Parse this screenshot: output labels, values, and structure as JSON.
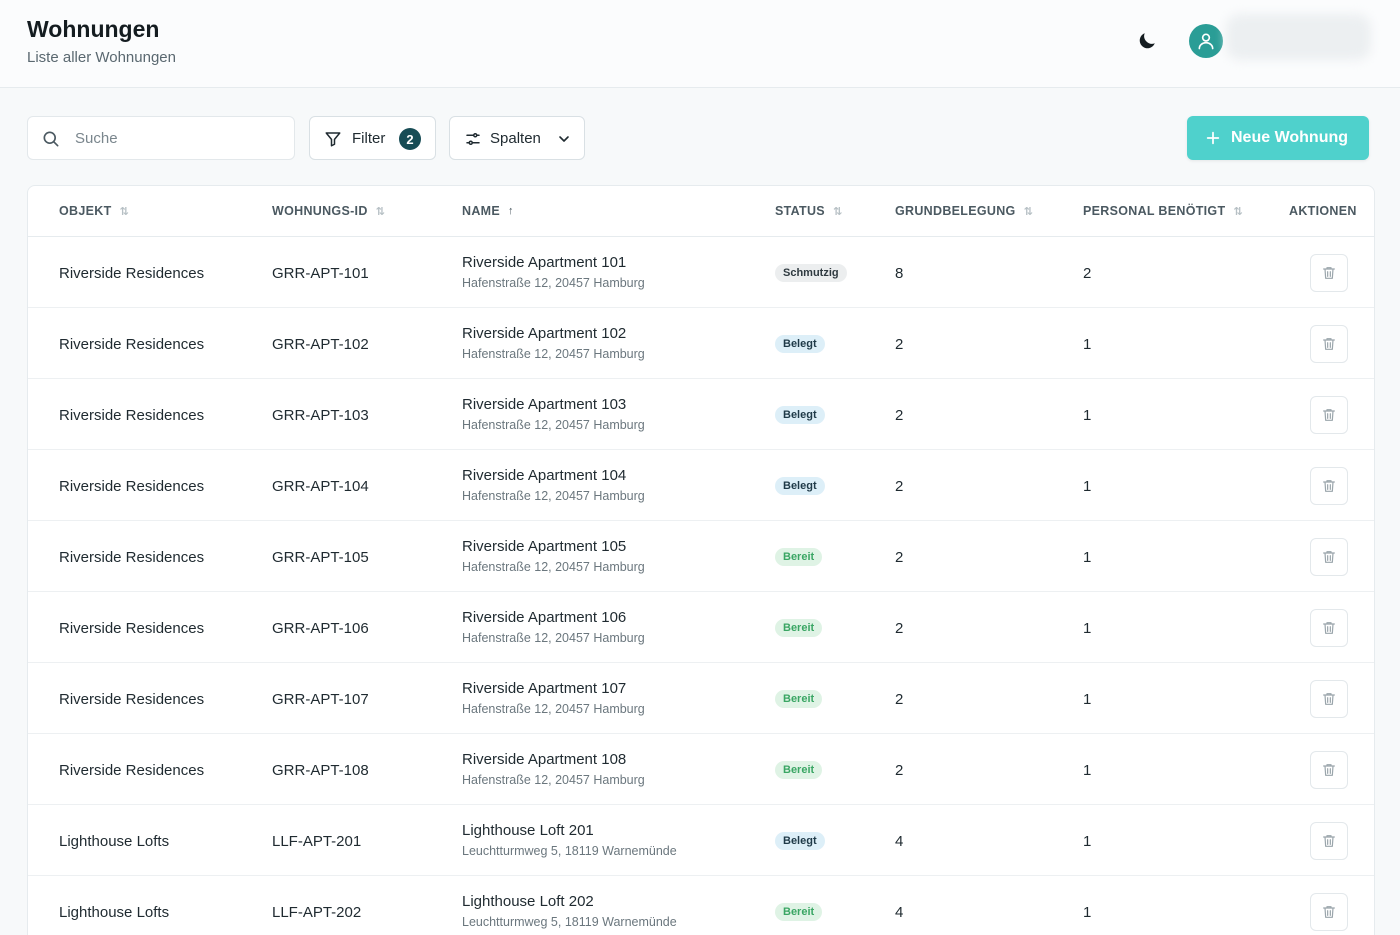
{
  "header": {
    "title": "Wohnungen",
    "subtitle": "Liste aller Wohnungen"
  },
  "toolbar": {
    "search_placeholder": "Suche",
    "filter_label": "Filter",
    "filter_count": "2",
    "columns_label": "Spalten",
    "new_label": "Neue Wohnung"
  },
  "colors": {
    "accent": "#4fd1cc",
    "avatar": "#2a9d96",
    "filter_badge": "#174c55"
  },
  "table": {
    "columns": [
      {
        "label": "OBJEKT",
        "sort": "none"
      },
      {
        "label": "WOHNUNGS-ID",
        "sort": "none"
      },
      {
        "label": "NAME",
        "sort": "asc"
      },
      {
        "label": "STATUS",
        "sort": "none"
      },
      {
        "label": "GRUNDBELEGUNG",
        "sort": "none"
      },
      {
        "label": "PERSONAL BENÖTIGT",
        "sort": "none"
      },
      {
        "label": "AKTIONEN",
        "sort": "off"
      }
    ],
    "rows": [
      {
        "objekt": "Riverside Residences",
        "id": "GRR-APT-101",
        "name": "Riverside Apartment 101",
        "address": "Hafenstraße 12, 20457 Hamburg",
        "status": "Schmutzig",
        "status_kind": "schmutzig",
        "grundbelegung": "8",
        "personal": "2"
      },
      {
        "objekt": "Riverside Residences",
        "id": "GRR-APT-102",
        "name": "Riverside Apartment 102",
        "address": "Hafenstraße 12, 20457 Hamburg",
        "status": "Belegt",
        "status_kind": "belegt",
        "grundbelegung": "2",
        "personal": "1"
      },
      {
        "objekt": "Riverside Residences",
        "id": "GRR-APT-103",
        "name": "Riverside Apartment 103",
        "address": "Hafenstraße 12, 20457 Hamburg",
        "status": "Belegt",
        "status_kind": "belegt",
        "grundbelegung": "2",
        "personal": "1"
      },
      {
        "objekt": "Riverside Residences",
        "id": "GRR-APT-104",
        "name": "Riverside Apartment 104",
        "address": "Hafenstraße 12, 20457 Hamburg",
        "status": "Belegt",
        "status_kind": "belegt",
        "grundbelegung": "2",
        "personal": "1"
      },
      {
        "objekt": "Riverside Residences",
        "id": "GRR-APT-105",
        "name": "Riverside Apartment 105",
        "address": "Hafenstraße 12, 20457 Hamburg",
        "status": "Bereit",
        "status_kind": "bereit",
        "grundbelegung": "2",
        "personal": "1"
      },
      {
        "objekt": "Riverside Residences",
        "id": "GRR-APT-106",
        "name": "Riverside Apartment 106",
        "address": "Hafenstraße 12, 20457 Hamburg",
        "status": "Bereit",
        "status_kind": "bereit",
        "grundbelegung": "2",
        "personal": "1"
      },
      {
        "objekt": "Riverside Residences",
        "id": "GRR-APT-107",
        "name": "Riverside Apartment 107",
        "address": "Hafenstraße 12, 20457 Hamburg",
        "status": "Bereit",
        "status_kind": "bereit",
        "grundbelegung": "2",
        "personal": "1"
      },
      {
        "objekt": "Riverside Residences",
        "id": "GRR-APT-108",
        "name": "Riverside Apartment 108",
        "address": "Hafenstraße 12, 20457 Hamburg",
        "status": "Bereit",
        "status_kind": "bereit",
        "grundbelegung": "2",
        "personal": "1"
      },
      {
        "objekt": "Lighthouse Lofts",
        "id": "LLF-APT-201",
        "name": "Lighthouse Loft 201",
        "address": "Leuchtturmweg 5, 18119 Warnemünde",
        "status": "Belegt",
        "status_kind": "belegt",
        "grundbelegung": "4",
        "personal": "1"
      },
      {
        "objekt": "Lighthouse Lofts",
        "id": "LLF-APT-202",
        "name": "Lighthouse Loft 202",
        "address": "Leuchtturmweg 5, 18119 Warnemünde",
        "status": "Bereit",
        "status_kind": "bereit",
        "grundbelegung": "4",
        "personal": "1"
      }
    ]
  }
}
